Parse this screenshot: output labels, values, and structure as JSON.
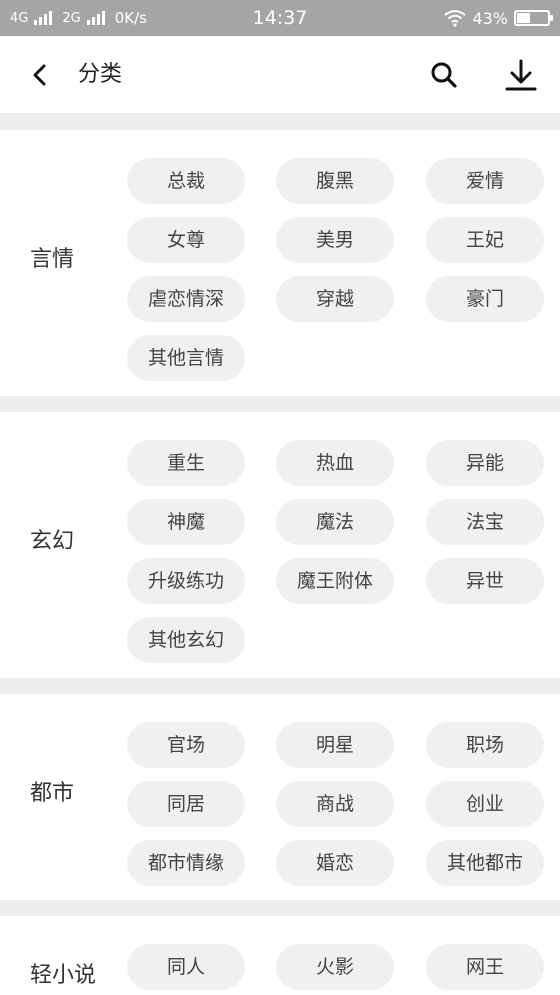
{
  "status_bar": {
    "net1": "4G",
    "net2": "2G",
    "speed": "0K/s",
    "time": "14:37",
    "battery": "43%",
    "battery_level": 0.43
  },
  "header": {
    "title": "分类",
    "back_icon": "chevron-left-icon",
    "search_icon": "search-icon",
    "download_icon": "download-icon"
  },
  "sections": [
    {
      "label": "言情",
      "tags": [
        "总裁",
        "腹黑",
        "爱情",
        "女尊",
        "美男",
        "王妃",
        "虐恋情深",
        "穿越",
        "豪门",
        "其他言情"
      ]
    },
    {
      "label": "玄幻",
      "tags": [
        "重生",
        "热血",
        "异能",
        "神魔",
        "魔法",
        "法宝",
        "升级练功",
        "魔王附体",
        "异世",
        "其他玄幻"
      ]
    },
    {
      "label": "都市",
      "tags": [
        "官场",
        "明星",
        "职场",
        "同居",
        "商战",
        "创业",
        "都市情缘",
        "婚恋",
        "其他都市"
      ]
    },
    {
      "label": "轻小说",
      "tags": [
        "同人",
        "火影",
        "网王"
      ]
    }
  ]
}
